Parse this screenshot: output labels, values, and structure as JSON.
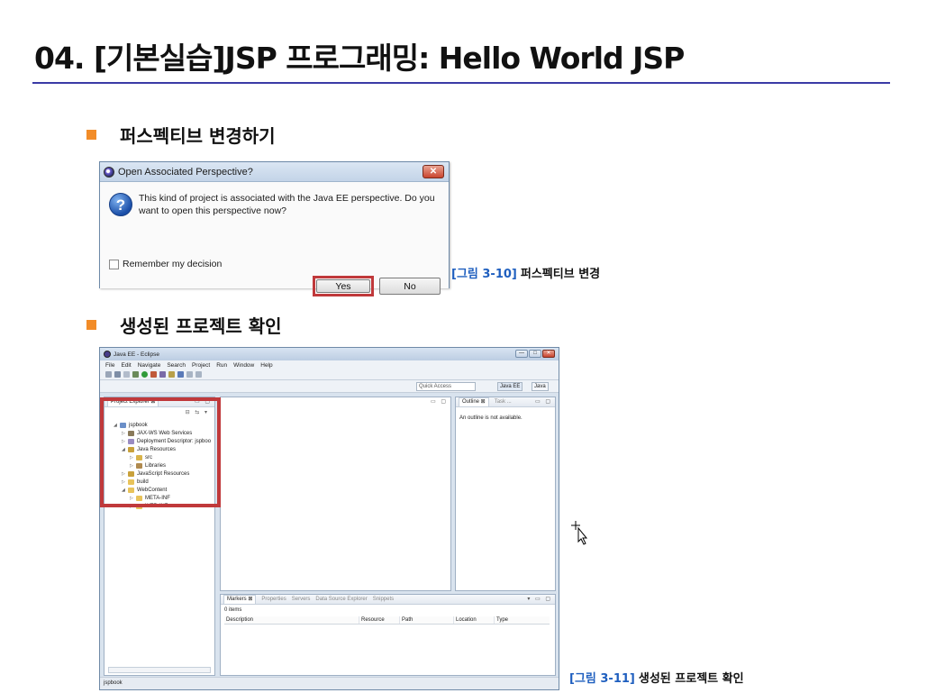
{
  "slide": {
    "title": "04. [기본실습]JSP 프로그래밍: Hello World JSP",
    "bullet1": "퍼스펙티브 변경하기",
    "bullet2": "생성된 프로젝트 확인",
    "caption1": {
      "num": "[그림 3-10]",
      "text": "퍼스펙티브 변경"
    },
    "caption2": {
      "num": "[그림 3-11]",
      "text": "생성된 프로젝트 확인"
    },
    "accent_color": "#f28c28",
    "highlight_color": "#c0393b"
  },
  "dialog": {
    "title": "Open Associated Perspective?",
    "close": "✕",
    "icon": "question-icon",
    "message": "This kind of project is associated with the Java EE perspective.  Do you want to open this perspective now?",
    "remember": "Remember my decision",
    "yes": "Yes",
    "no": "No"
  },
  "eclipse": {
    "title": "Java EE - Eclipse",
    "window_buttons": [
      "—",
      "□",
      "✕"
    ],
    "menu": [
      "File",
      "Edit",
      "Navigate",
      "Search",
      "Project",
      "Run",
      "Window",
      "Help"
    ],
    "quick_access": "Quick Access",
    "perspectives": [
      "Java EE",
      "Java"
    ],
    "project_explorer": {
      "tab": "Project Explorer ⊠",
      "tree": [
        {
          "label": "jspbook",
          "arrow": "◢",
          "icon": "ico-proj",
          "depth": 0
        },
        {
          "label": "JAX-WS Web Services",
          "arrow": "▷",
          "icon": "ico-ws",
          "depth": 1
        },
        {
          "label": "Deployment Descriptor: jspboo",
          "arrow": "▷",
          "icon": "ico-dd",
          "depth": 1
        },
        {
          "label": "Java Resources",
          "arrow": "◢",
          "icon": "ico-jr",
          "depth": 1
        },
        {
          "label": "src",
          "arrow": "▷",
          "icon": "ico-src",
          "depth": 2
        },
        {
          "label": "Libraries",
          "arrow": "▷",
          "icon": "ico-lib",
          "depth": 2
        },
        {
          "label": "JavaScript Resources",
          "arrow": "▷",
          "icon": "ico-js",
          "depth": 1
        },
        {
          "label": "build",
          "arrow": "▷",
          "icon": "ico-folder",
          "depth": 1
        },
        {
          "label": "WebContent",
          "arrow": "◢",
          "icon": "ico-folder",
          "depth": 1
        },
        {
          "label": "META-INF",
          "arrow": "▷",
          "icon": "ico-folder",
          "depth": 2
        },
        {
          "label": "WEB-INF",
          "arrow": "▷",
          "icon": "ico-folder",
          "depth": 2
        }
      ]
    },
    "outline": {
      "tabs": [
        "Outline ⊠",
        "Task ..."
      ],
      "message": "An outline is not available."
    },
    "bottom": {
      "tabs": [
        "Markers ⊠",
        "Properties",
        "Servers",
        "Data Source Explorer",
        "Snippets"
      ],
      "count": "0 items",
      "columns": [
        "Description",
        "Resource",
        "Path",
        "Location",
        "Type"
      ]
    },
    "status": "jspbook"
  }
}
